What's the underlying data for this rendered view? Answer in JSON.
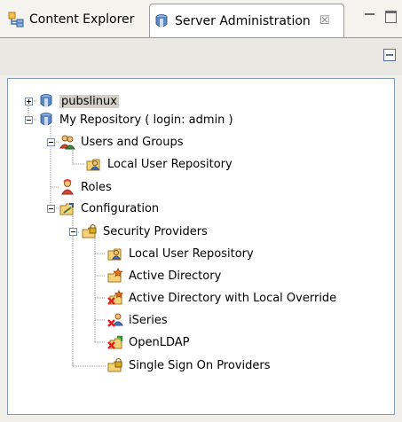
{
  "tabs": [
    {
      "label": "Content Explorer",
      "active": false,
      "icon": "content-explorer-icon"
    },
    {
      "label": "Server Administration",
      "active": true,
      "icon": "server-admin-icon",
      "close_glyph": "☒"
    }
  ],
  "tree": {
    "servers": [
      {
        "label": "pubslinux",
        "expanded": false,
        "selected": true,
        "icon": "server-icon"
      },
      {
        "label": "My Repository ( login: admin )",
        "expanded": true,
        "icon": "server-icon"
      }
    ],
    "users_and_groups": {
      "label": "Users and Groups",
      "icon": "users-groups-icon"
    },
    "local_user_repository": {
      "label": "Local User Repository",
      "icon": "user-repository-folder-icon"
    },
    "roles": {
      "label": "Roles",
      "icon": "roles-icon"
    },
    "configuration": {
      "label": "Configuration",
      "icon": "configuration-folder-icon"
    },
    "security_providers": {
      "label": "Security Providers",
      "icon": "security-folder-icon"
    },
    "providers": [
      {
        "label": "Local User Repository",
        "icon": "user-repository-folder-icon"
      },
      {
        "label": "Active Directory",
        "icon": "directory-star-folder-icon"
      },
      {
        "label": "Active Directory with Local Override",
        "icon": "directory-star-disabled-icon"
      },
      {
        "label": "iSeries",
        "icon": "iseries-disabled-icon"
      },
      {
        "label": "OpenLDAP",
        "icon": "openldap-disabled-icon"
      }
    ],
    "sso": {
      "label": "Single Sign On Providers",
      "icon": "security-folder-icon"
    }
  },
  "colors": {
    "selection": "#d4d0c8",
    "border": "#7f9db9",
    "tree_line": "#999999"
  }
}
